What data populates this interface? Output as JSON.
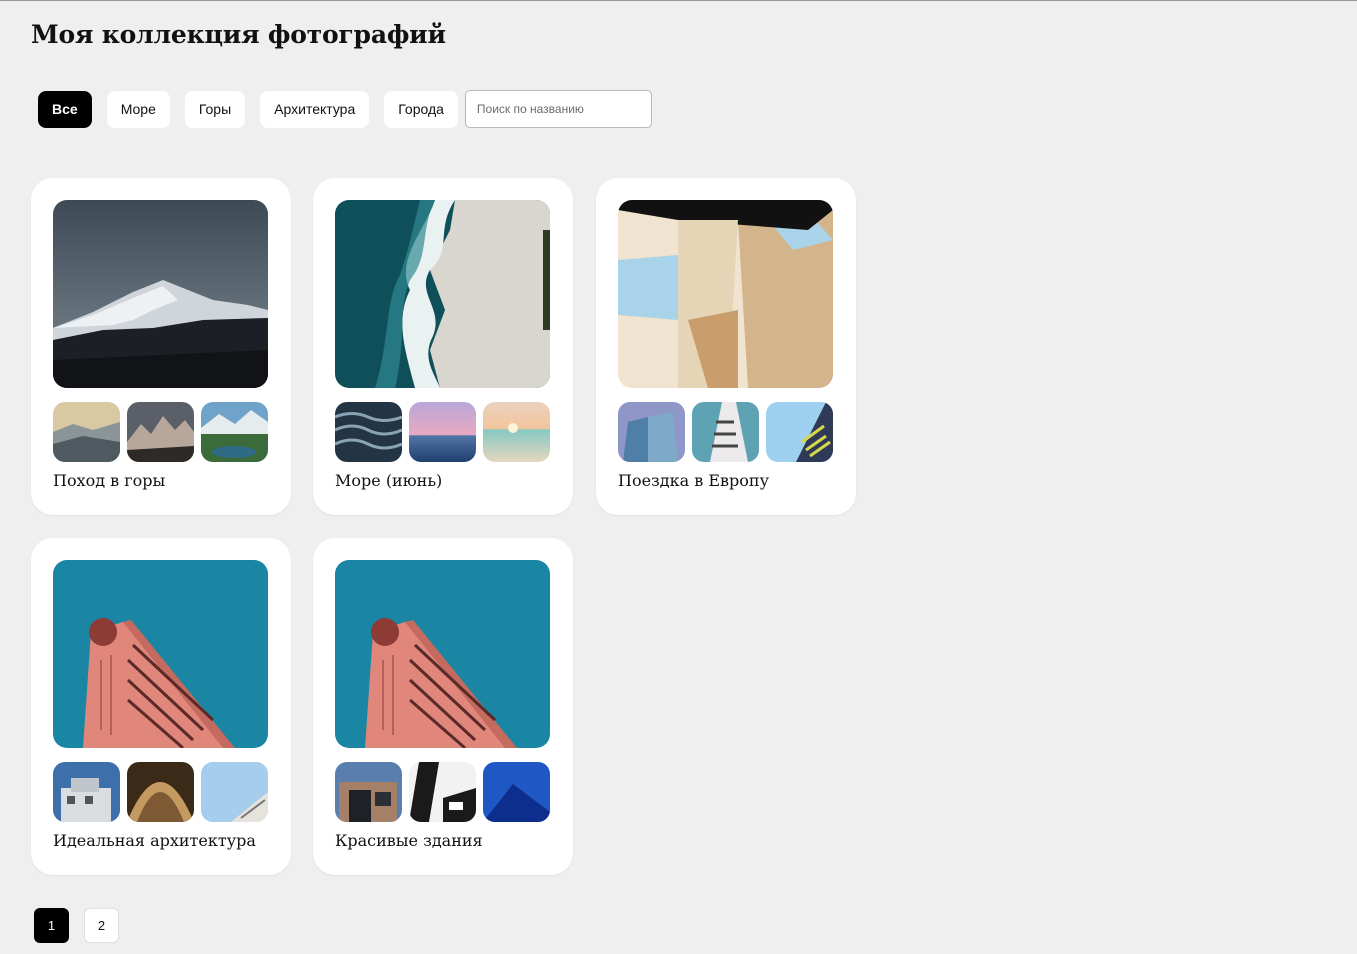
{
  "page_title": "Моя коллекция фотографий",
  "filters": {
    "chips": [
      {
        "label": "Все",
        "active": true
      },
      {
        "label": "Море",
        "active": false
      },
      {
        "label": "Горы",
        "active": false
      },
      {
        "label": "Архитектура",
        "active": false
      },
      {
        "label": "Города",
        "active": false
      }
    ],
    "search_placeholder": "Поиск по названию",
    "search_value": ""
  },
  "albums": [
    {
      "title": "Поход в горы"
    },
    {
      "title": "Море (июнь)"
    },
    {
      "title": "Поездка в Европу"
    },
    {
      "title": "Идеальная архитектура"
    },
    {
      "title": "Красивые здания"
    }
  ],
  "pagination": {
    "pages": [
      "1",
      "2"
    ],
    "current": "1"
  },
  "colors": {
    "background": "#f0efef",
    "card": "#ffffff",
    "active": "#000000",
    "sky_teal": "#1b86a3",
    "building_pink": "#e0867a"
  }
}
